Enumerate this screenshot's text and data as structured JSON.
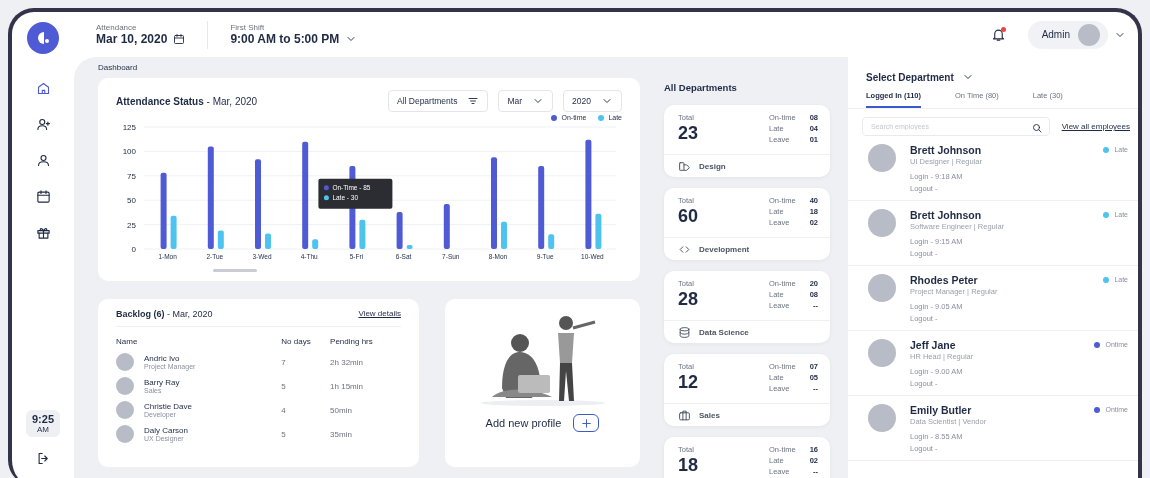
{
  "header": {
    "date_label": "Attendance",
    "date": "Mar 10, 2020",
    "shift_label": "First Shift",
    "shift": "9:00 AM to 5:00 PM",
    "user": "Admin",
    "has_notifications": true
  },
  "nav": [
    {
      "kind": "home",
      "selected": true
    },
    {
      "kind": "add-user",
      "selected": false
    },
    {
      "kind": "user",
      "selected": false
    },
    {
      "kind": "calendar",
      "selected": false
    },
    {
      "kind": "gift",
      "selected": false
    }
  ],
  "clock": {
    "time": "9:25",
    "period": "AM"
  },
  "breadcrumb": "Dashboard",
  "attendance": {
    "title": "**Attendance  Status** - Mar, 2020",
    "filters": [
      {
        "label": "All Departments",
        "kind": "filter"
      },
      {
        "label": "Mar",
        "kind": "dropdown"
      },
      {
        "label": "2020",
        "kind": "dropdown"
      }
    ],
    "chart_data": {
      "type": "bar",
      "categories": [
        "1-Mon",
        "2-Tue",
        "3-Wed",
        "4-Thu",
        "5-Fri",
        "6-Sat",
        "7-Sun",
        "8-Mon",
        "9-Tue",
        "10-Wed"
      ],
      "series": [
        {
          "name": "On-time",
          "color": "#4f5bd5",
          "values": [
            78,
            105,
            92,
            110,
            85,
            38,
            46,
            94,
            85,
            112
          ]
        },
        {
          "name": "Late",
          "color": "#4fc3ef",
          "values": [
            34,
            19,
            16,
            10,
            30,
            4,
            null,
            28,
            15,
            36
          ]
        }
      ],
      "ylim": [
        0,
        125
      ],
      "grid": true,
      "yticks": [
        0,
        25,
        50,
        75,
        100,
        125
      ],
      "annotations": [
        {
          "x": "5-Fri",
          "text": "On-Time - 85"
        },
        {
          "x": "5-Fri",
          "text": "Late - 30"
        }
      ]
    }
  },
  "backlog": {
    "title": "**Backlog (6)** - Mar, 2020",
    "link": "View details",
    "columns": [
      "Name",
      "No days",
      "Pending hrs"
    ],
    "rows": [
      {
        "name": "Andric Ivo",
        "role": "Project Manager",
        "days": "7",
        "pending": "2h 32min"
      },
      {
        "name": "Barry Ray",
        "role": "Sales",
        "days": "5",
        "pending": "1h 15min"
      },
      {
        "name": "Christie Dave",
        "role": "Developer",
        "days": "4",
        "pending": "50min"
      },
      {
        "name": "Daly Carson",
        "role": "UX Designer",
        "days": "5",
        "pending": "35min"
      }
    ]
  },
  "add_profile": {
    "label": "Add new profile"
  },
  "departments": {
    "title": "All Departments",
    "cards": [
      {
        "total_label": "Total",
        "total": "23",
        "stats": [
          {
            "label": "On-time",
            "value": "08"
          },
          {
            "label": "Late",
            "value": "04"
          },
          {
            "label": "Leave",
            "value": "01"
          }
        ],
        "name": "Design",
        "kind": "design"
      },
      {
        "total_label": "Total",
        "total": "60",
        "stats": [
          {
            "label": "On-time",
            "value": "40"
          },
          {
            "label": "Late",
            "value": "18"
          },
          {
            "label": "Leave",
            "value": "02"
          }
        ],
        "name": "Development",
        "kind": "code"
      },
      {
        "total_label": "Total",
        "total": "28",
        "stats": [
          {
            "label": "On-time",
            "value": "20"
          },
          {
            "label": "Late",
            "value": "08"
          },
          {
            "label": "Leave",
            "value": "--"
          }
        ],
        "name": "Data Science",
        "kind": "database"
      },
      {
        "total_label": "Total",
        "total": "12",
        "stats": [
          {
            "label": "On-time",
            "value": "07"
          },
          {
            "label": "Late",
            "value": "05"
          },
          {
            "label": "Leave",
            "value": "--"
          }
        ],
        "name": "Sales",
        "kind": "briefcase"
      },
      {
        "total_label": "Total",
        "total": "18",
        "stats": [
          {
            "label": "On-time",
            "value": "16"
          },
          {
            "label": "Late",
            "value": "02"
          },
          {
            "label": "Leave",
            "value": "--"
          }
        ]
      }
    ]
  },
  "employees": {
    "title": "Select Department",
    "tabs": [
      {
        "label": "Logged In (110)",
        "selected": true
      },
      {
        "label": "On Time (80)",
        "selected": false
      },
      {
        "label": "Late (30)",
        "selected": false
      }
    ],
    "search_placeholder": "Search employees",
    "link": "View all employees",
    "list": [
      {
        "name": "Brett Johnson",
        "role": "UI Designer  |  Regular",
        "login": "Login - 9:18 AM",
        "logout": "Logout  -",
        "status": "Late",
        "color": "#4fc3ef"
      },
      {
        "name": "Brett Johnson",
        "role": "Software Engineer  |  Regular",
        "login": "Login - 9:15 AM",
        "logout": "Logout  -",
        "status": "Late",
        "color": "#4fc3ef"
      },
      {
        "name": "Rhodes Peter",
        "role": "Project Manager  |  Regular",
        "login": "Login - 9.05 AM",
        "logout": "Logout  -",
        "status": "Late",
        "color": "#4fc3ef"
      },
      {
        "name": "Jeff Jane",
        "role": "HR Head  |  Regular",
        "login": "Login - 9.00 AM",
        "logout": "Logout  -",
        "status": "Ontime",
        "color": "#4f5bd5"
      },
      {
        "name": "Emily Butler",
        "role": "Data Scientist  |  Vendor",
        "login": "Login - 8.55 AM",
        "logout": "Logout  -",
        "status": "Ontime",
        "color": "#4f5bd5"
      }
    ]
  }
}
